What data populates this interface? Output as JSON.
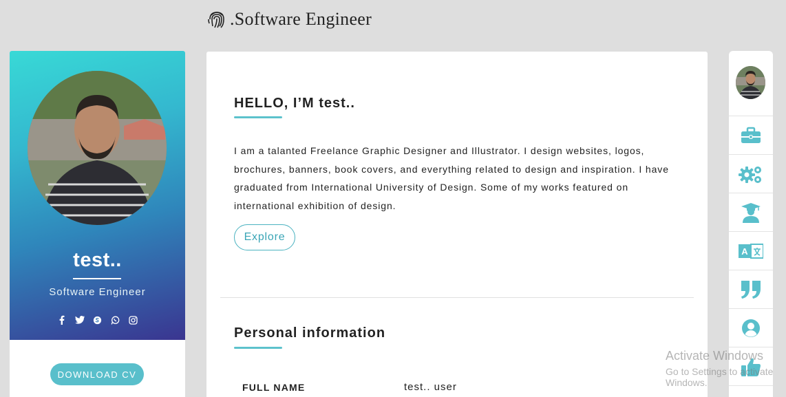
{
  "header": {
    "title": ".Software Engineer",
    "logo_icon": "fingerprint-icon"
  },
  "profile": {
    "name": "test..",
    "role": "Software Engineer",
    "socials": [
      "facebook-icon",
      "twitter-icon",
      "skype-icon",
      "whatsapp-icon",
      "instagram-icon"
    ],
    "download_label": "DOWNLOAD CV"
  },
  "about": {
    "title": "HELLO, I’M test..",
    "text": "I am a talanted Freelance Graphic Designer and Illustrator. I design websites, logos, brochures, banners, book covers, and everything related to design and inspiration. I have graduated from International University of Design. Some of my works featured on international exhibition of design.",
    "explore_label": "Explore"
  },
  "personal": {
    "title": "Personal information",
    "rows": [
      {
        "label": "FULL NAME",
        "value": "test.. user"
      }
    ]
  },
  "right_nav": {
    "items": [
      "briefcase-icon",
      "gears-icon",
      "graduate-icon",
      "translate-icon",
      "quote-icon",
      "user-circle-icon",
      "thumbs-up-icon"
    ]
  },
  "watermark": {
    "line1": "Activate Windows",
    "line2": "Go to Settings to activate Windows."
  },
  "colors": {
    "accent": "#5cc2cc",
    "gradient_top": "#38d9d6",
    "gradient_bottom": "#3a3590"
  }
}
